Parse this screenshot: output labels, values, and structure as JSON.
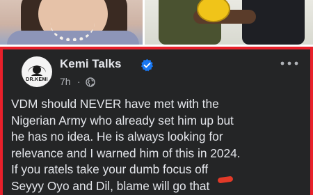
{
  "post": {
    "author": "Kemi Talks",
    "time": "7h",
    "separator": "·",
    "avatar_text": "DR.KEMI",
    "text_lines": [
      "VDM should NEVER have met with the",
      "Nigerian Army who already set him up but",
      "he has no idea.  He is always looking for",
      "relevance and I warned him of this in 2024.",
      "If you ratels take your dumb focus off",
      "Seyyy Oyo and Dil, blame will go that"
    ]
  },
  "colors": {
    "card_background": "#242526",
    "card_border": "#e8202a",
    "primary_text": "#e4e6eb",
    "secondary_text": "#b0b3b8",
    "verified_badge": "#1877f2"
  },
  "icons": {
    "verified": "verified-badge-icon",
    "privacy": "globe-icon",
    "more": "more-options-icon"
  }
}
